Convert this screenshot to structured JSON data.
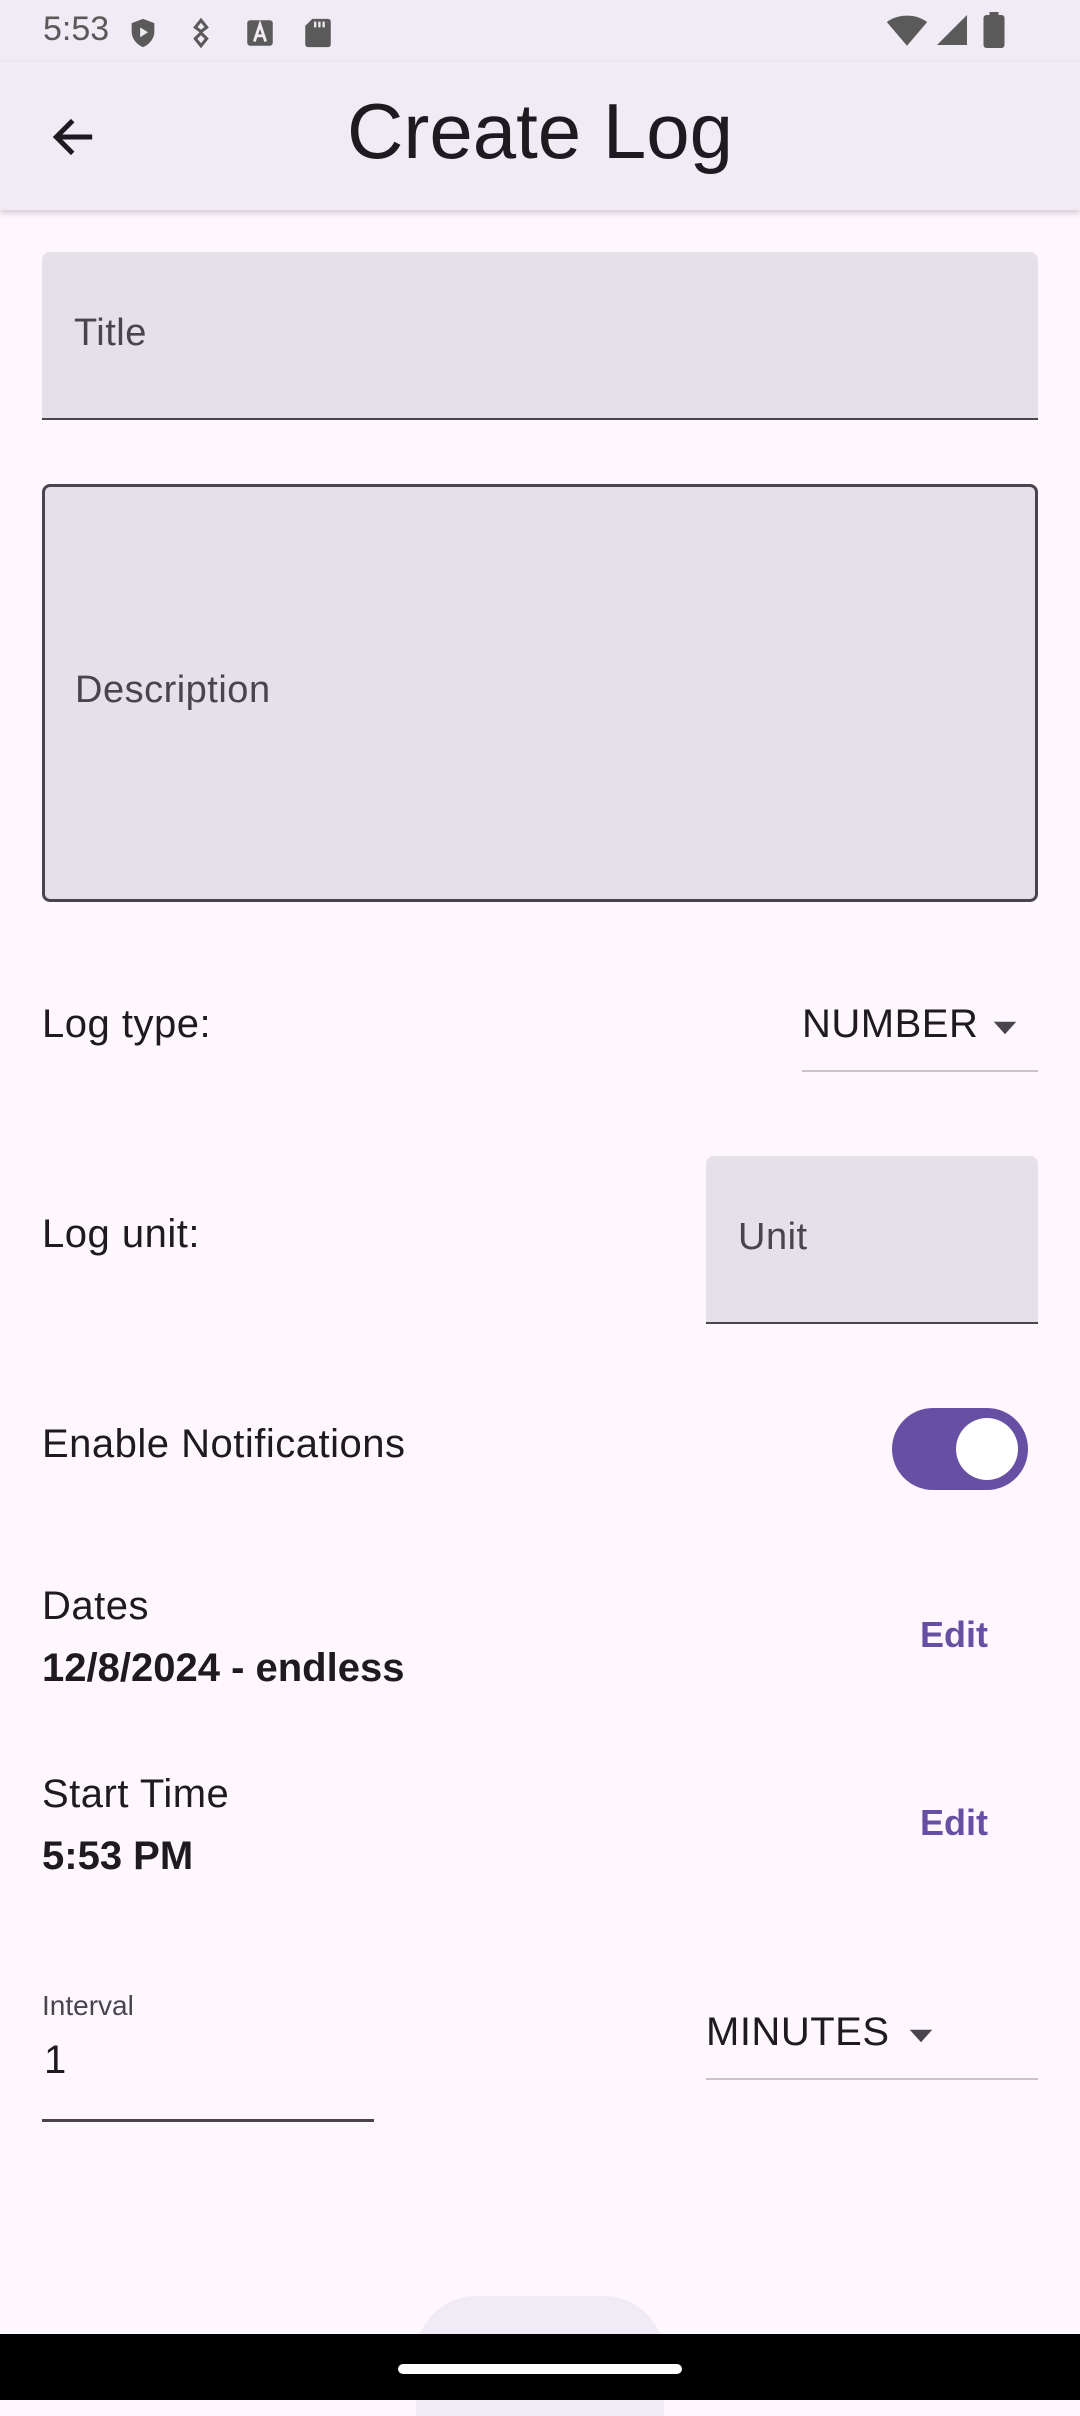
{
  "status_bar": {
    "time": "5:53",
    "icons_left": [
      "shield-play-icon",
      "usb-debug-icon",
      "a-box-icon",
      "sd-card-icon"
    ],
    "icons_right": [
      "wifi-icon",
      "signal-icon",
      "battery-icon"
    ]
  },
  "app_bar": {
    "title": "Create Log",
    "back_icon": "arrow-back-icon"
  },
  "form": {
    "title_placeholder": "Title",
    "title_value": "",
    "description_placeholder": "Description",
    "description_value": "",
    "log_type_label": "Log type:",
    "log_type_value": "NUMBER",
    "log_unit_label": "Log unit:",
    "unit_placeholder": "Unit",
    "unit_value": "",
    "notifications_label": "Enable Notifications",
    "notifications_enabled": true,
    "dates_label": "Dates",
    "dates_value": "12/8/2024 - endless",
    "dates_edit": "Edit",
    "start_time_label": "Start Time",
    "start_time_value": "5:53 PM",
    "start_time_edit": "Edit",
    "interval_label": "Interval",
    "interval_value": "1",
    "interval_unit": "MINUTES"
  },
  "colors": {
    "accent": "#6750a4",
    "field_fill": "#e6e0e9",
    "background": "#fef7fe",
    "app_bar": "#f0ebf4"
  }
}
